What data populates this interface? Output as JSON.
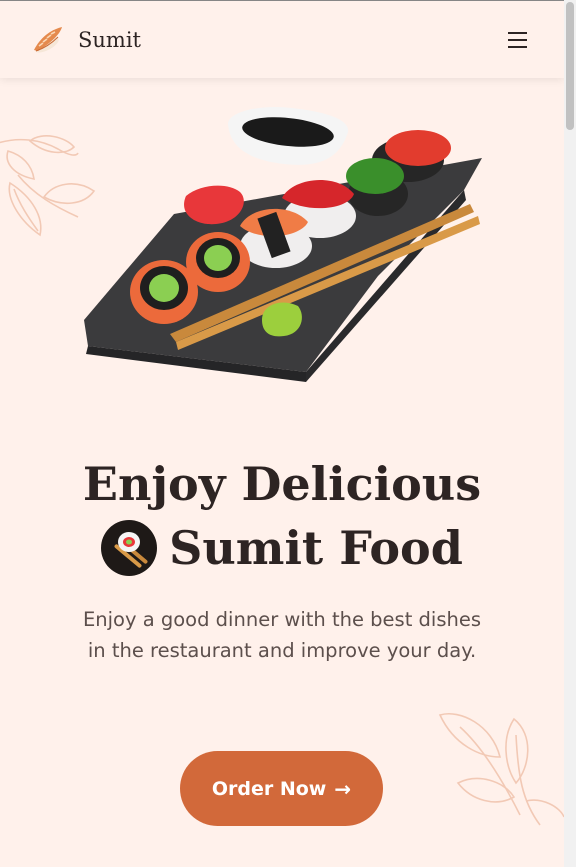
{
  "brand": {
    "name": "Sumit",
    "logo_icon": "sushi-icon"
  },
  "header": {
    "menu_icon": "hamburger-menu-icon"
  },
  "hero": {
    "image": "sushi-board-illustration",
    "title_line1": "Enjoy Delicious",
    "title_line2": "Sumit Food",
    "title_badge_icon": "sushi-roll-icon",
    "description": "Enjoy a good dinner with the best dishes in the restaurant and improve your day.",
    "cta_label": "Order Now",
    "cta_icon": "arrow-right-icon"
  },
  "colors": {
    "background": "#fff1eb",
    "accent": "#d2693a",
    "text_dark": "#2d2423",
    "text_muted": "#5c4f4c",
    "leaf_decoration": "#f2c9b5"
  }
}
